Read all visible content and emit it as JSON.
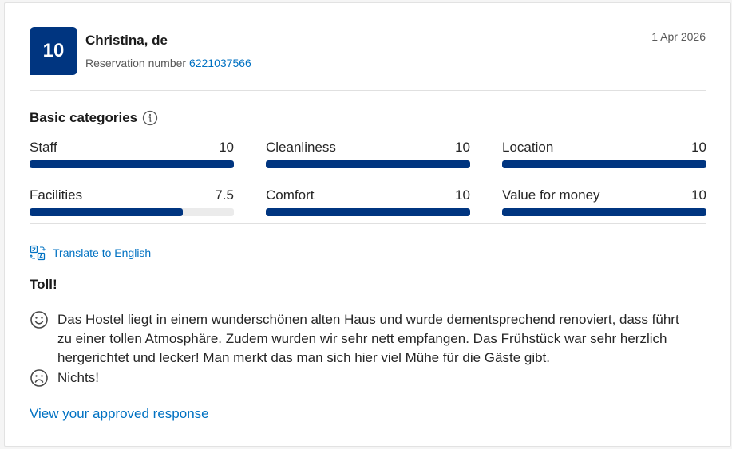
{
  "review": {
    "score": "10",
    "guest_name": "Christina, de",
    "reservation_label": "Reservation number",
    "reservation_number": "6221037566",
    "date": "1 Apr 2026"
  },
  "categories": {
    "title": "Basic categories",
    "info_icon": "info-icon",
    "items": [
      {
        "label": "Staff",
        "score": "10",
        "fill": 1.0
      },
      {
        "label": "Cleanliness",
        "score": "10",
        "fill": 1.0
      },
      {
        "label": "Location",
        "score": "10",
        "fill": 1.0
      },
      {
        "label": "Facilities",
        "score": "7.5",
        "fill": 0.75
      },
      {
        "label": "Comfort",
        "score": "10",
        "fill": 1.0
      },
      {
        "label": "Value for money",
        "score": "10",
        "fill": 1.0
      }
    ]
  },
  "translate": {
    "label": "Translate to English",
    "icon": "translate-icon"
  },
  "content": {
    "title": "Toll!",
    "positive": "Das Hostel liegt in einem wunderschönen alten Haus und wurde dementsprechend renoviert, dass führt zu einer tollen Atmosphäre. Zudem wurden wir sehr nett empfangen. Das Frühstück war sehr herzlich hergerichtet und lecker! Man merkt das man sich hier viel Mühe für die Gäste gibt.",
    "negative": "Nichts!"
  },
  "response_link": "View your approved response",
  "colors": {
    "brand": "#003580",
    "link": "#0071c2"
  }
}
